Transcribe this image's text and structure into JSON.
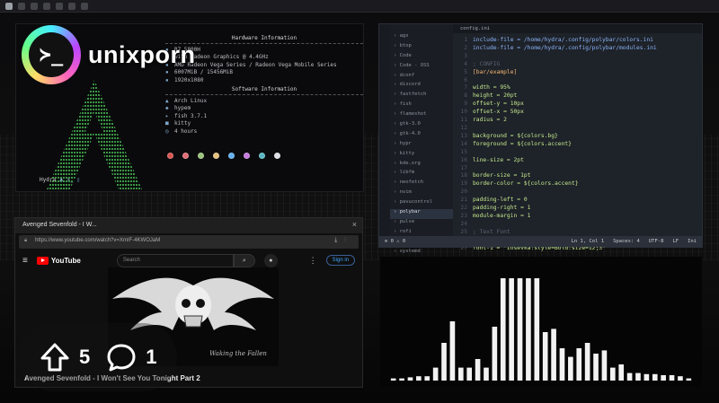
{
  "brand": {
    "name": "unixporn",
    "logo_glyph": "≻_"
  },
  "fetch": {
    "hardware_title": "Hardware Information",
    "hardware": [
      "R7 5800H",
      "with Radeon Graphics @ 4.4GHz",
      "AMD Radeon Vega Series / Radeon Vega Mobile Series",
      "6007MiB / 15456MiB",
      "1920x1080"
    ],
    "software_title": "Software Information",
    "software": [
      {
        "icon": "arch-icon",
        "value": "Arch Linux"
      },
      {
        "icon": "wm-icon",
        "value": "hypem"
      },
      {
        "icon": "shell-icon",
        "value": "fish 3.7.1"
      },
      {
        "icon": "terminal-icon",
        "value": "kitty"
      },
      {
        "icon": "clock-icon",
        "value": "4 hours"
      }
    ],
    "palette": [
      "#d9534f",
      "#e06c75",
      "#98c379",
      "#e5c07b",
      "#61afef",
      "#c678dd",
      "#56b6c2",
      "#dcdfe4"
    ],
    "prompt_user": "Hydra",
    "prompt_symbol": "⮝ ≻_ ▯"
  },
  "editor": {
    "tab": "config.ini",
    "tree": [
      "ags",
      "btop",
      "Code",
      "Code - OSS",
      "dconf",
      "discord",
      "fastfetch",
      "fish",
      "flameshot",
      "gtk-3.0",
      "gtk-4.0",
      "hypr",
      "kitty",
      "kde.org",
      "libfm",
      "neofetch",
      "nvim",
      "pavucontrol",
      "polybar",
      "pulse",
      "rofi",
      "swaync",
      "systemd",
      "waybar",
      "wallpapers"
    ],
    "tree_selected": "polybar",
    "lines": [
      {
        "n": "1",
        "text": "include-file = /home/hydra/.config/polybar/colors.ini",
        "cls": "k"
      },
      {
        "n": "2",
        "text": "include-file = /home/hydra/.config/polybar/modules.ini",
        "cls": "k"
      },
      {
        "n": "3",
        "text": "",
        "cls": ""
      },
      {
        "n": "4",
        "text": ";   CONFIG",
        "cls": "c"
      },
      {
        "n": "5",
        "text": "[bar/example]",
        "cls": "h"
      },
      {
        "n": "6",
        "text": "",
        "cls": ""
      },
      {
        "n": "7",
        "text": "width = 95%",
        "cls": "v"
      },
      {
        "n": "8",
        "text": "height = 20pt",
        "cls": "v"
      },
      {
        "n": "9",
        "text": "offset-y = 10px",
        "cls": "v"
      },
      {
        "n": "10",
        "text": "offset-x = 50px",
        "cls": "v"
      },
      {
        "n": "11",
        "text": "radius = 2",
        "cls": "v"
      },
      {
        "n": "12",
        "text": "",
        "cls": ""
      },
      {
        "n": "13",
        "text": "background = ${colors.bg}",
        "cls": "v"
      },
      {
        "n": "14",
        "text": "foreground = ${colors.accent}",
        "cls": "v"
      },
      {
        "n": "15",
        "text": "",
        "cls": ""
      },
      {
        "n": "16",
        "text": "line-size = 2pt",
        "cls": "v"
      },
      {
        "n": "17",
        "text": "",
        "cls": ""
      },
      {
        "n": "18",
        "text": "border-size = 1pt",
        "cls": "v"
      },
      {
        "n": "19",
        "text": "border-color = ${colors.accent}",
        "cls": "v"
      },
      {
        "n": "20",
        "text": "",
        "cls": ""
      },
      {
        "n": "21",
        "text": "padding-left = 0",
        "cls": "v"
      },
      {
        "n": "22",
        "text": "padding-right = 1",
        "cls": "v"
      },
      {
        "n": "23",
        "text": "module-margin = 1",
        "cls": "v"
      },
      {
        "n": "24",
        "text": "",
        "cls": ""
      },
      {
        "n": "25",
        "text": ";   Text Font",
        "cls": "c"
      },
      {
        "n": "26",
        "text": "font-0 = \"Iosevka:style=Bold:size=10;3\"",
        "cls": "v"
      },
      {
        "n": "27",
        "text": "font-1 = \"Iosevka:style=Bold:size=12;3\"",
        "cls": "v"
      }
    ],
    "status": {
      "left": "⊘ 0 ⚠ 0",
      "position": "Ln 1, Col 1",
      "spaces": "Spaces: 4",
      "encoding": "UTF-8",
      "eol": "LF",
      "lang": "Ini"
    }
  },
  "browser": {
    "window_title": "Avenged Sevenfold - I W...",
    "url": "https://www.youtube.com/watch?v=XmIF-4KWOJaM",
    "yt_logo": "YouTube",
    "search_placeholder": "Search",
    "signin": "Sign in",
    "video_title": "Avenged Sevenfold - I Won't See You Tonight Part 2",
    "video_caption": "Waking the Fallen"
  },
  "visualizer": {
    "levels": [
      0.02,
      0.02,
      0.03,
      0.04,
      0.04,
      0.12,
      0.35,
      0.55,
      0.12,
      0.12,
      0.2,
      0.12,
      0.5,
      0.95,
      0.95,
      0.95,
      0.95,
      0.95,
      0.45,
      0.48,
      0.3,
      0.22,
      0.3,
      0.35,
      0.25,
      0.28,
      0.12,
      0.15,
      0.07,
      0.07,
      0.06,
      0.06,
      0.05,
      0.05,
      0.04,
      0.02
    ]
  },
  "votes": {
    "up": "5",
    "comments": "1"
  }
}
